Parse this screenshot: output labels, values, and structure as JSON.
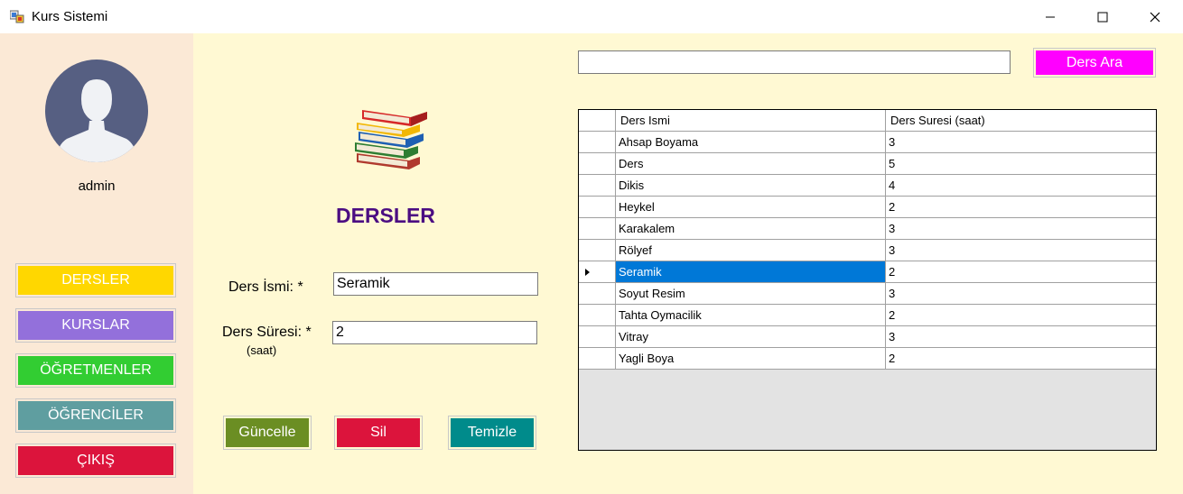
{
  "window": {
    "title": "Kurs Sistemi"
  },
  "sidebar": {
    "username": "admin",
    "nav": [
      {
        "label": "DERSLER",
        "color": "#ffd700"
      },
      {
        "label": "KURSLAR",
        "color": "#9370db"
      },
      {
        "label": "ÖĞRETMENLER",
        "color": "#32cd32"
      },
      {
        "label": "ÖĞRENCİLER",
        "color": "#5f9ea0"
      },
      {
        "label": "ÇIKIŞ",
        "color": "#dc143c"
      }
    ]
  },
  "form": {
    "heading": "DERSLER",
    "name_label": "Ders İsmi: *",
    "name_value": "Seramik",
    "duration_label": "Ders Süresi: *",
    "duration_unit": "(saat)",
    "duration_value": "2",
    "buttons": {
      "update": "Güncelle",
      "delete": "Sil",
      "clear": "Temizle"
    }
  },
  "search": {
    "value": "",
    "button_label": "Ders Ara"
  },
  "grid": {
    "columns": [
      "Ders Ismi",
      "Ders Suresi (saat)"
    ],
    "rows": [
      {
        "name": "Ahsap Boyama",
        "duration": "3",
        "selected": false
      },
      {
        "name": "Ders",
        "duration": "5",
        "selected": false
      },
      {
        "name": "Dikis",
        "duration": "4",
        "selected": false
      },
      {
        "name": "Heykel",
        "duration": "2",
        "selected": false
      },
      {
        "name": "Karakalem",
        "duration": "3",
        "selected": false
      },
      {
        "name": "Rölyef",
        "duration": "3",
        "selected": false
      },
      {
        "name": "Seramik",
        "duration": "2",
        "selected": true
      },
      {
        "name": "Soyut Resim",
        "duration": "3",
        "selected": false
      },
      {
        "name": "Tahta Oymacilik",
        "duration": "2",
        "selected": false
      },
      {
        "name": "Vitray",
        "duration": "3",
        "selected": false
      },
      {
        "name": "Yagli Boya",
        "duration": "2",
        "selected": false
      }
    ],
    "selection_color": "#0078d7"
  },
  "colors": {
    "sidebar_bg": "#fbe9d6",
    "main_bg": "#fff9d3",
    "heading": "#4b0d82",
    "update_btn": "#6b8e23",
    "delete_btn": "#dc143c",
    "clear_btn": "#008b8b",
    "search_btn": "#ff00ff"
  }
}
